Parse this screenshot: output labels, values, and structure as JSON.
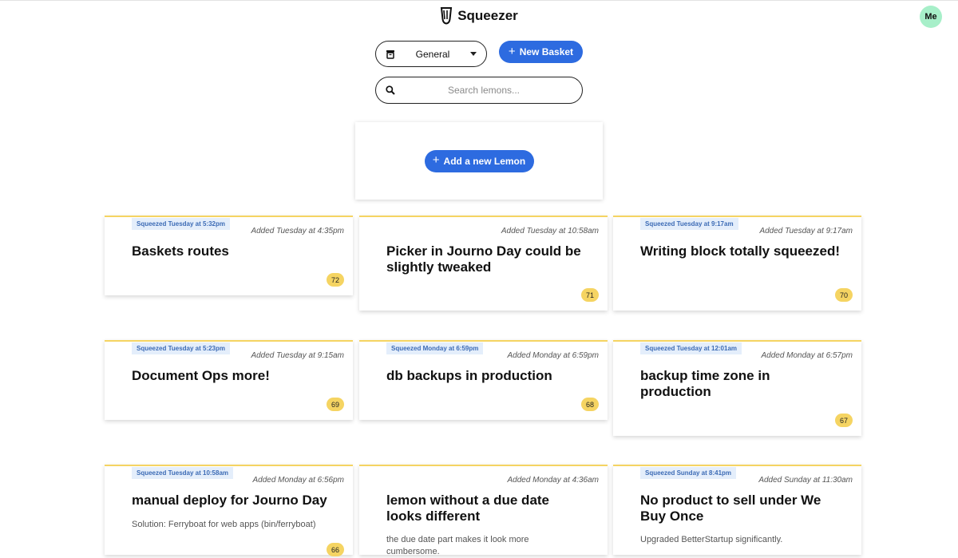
{
  "header": {
    "app_name": "Squeezer",
    "avatar_label": "Me"
  },
  "controls": {
    "basket_selected": "General",
    "new_basket_label": "New Basket",
    "search_placeholder": "Search lemons...",
    "add_lemon_label": "Add a new Lemon"
  },
  "colors": {
    "accent": "#2d6be0",
    "lemon": "#f5d462",
    "avatar": "#a7efc9",
    "squeezed_tag_bg": "#e4eefb"
  },
  "icons": {
    "logo": "squeezer-logo-icon",
    "basket": "basket-icon",
    "search": "search-icon",
    "dropdown": "chevron-down-icon",
    "plus": "plus-icon"
  },
  "lemons": [
    {
      "squeezed": "Squeezed Tuesday at 5:32pm",
      "added": "Added Tuesday at 4:35pm",
      "title": "Baskets routes",
      "description": "",
      "score": "72"
    },
    {
      "squeezed": "",
      "added": "Added Tuesday at 10:58am",
      "title": "Picker in Journo Day could be slightly tweaked",
      "description": "",
      "score": "71"
    },
    {
      "squeezed": "Squeezed Tuesday at 9:17am",
      "added": "Added Tuesday at 9:17am",
      "title": "Writing block totally squeezed!",
      "description": "",
      "score": "70"
    },
    {
      "squeezed": "Squeezed Tuesday at 5:23pm",
      "added": "Added Tuesday at 9:15am",
      "title": "Document Ops more!",
      "description": "",
      "score": "69"
    },
    {
      "squeezed": "Squeezed Monday at 6:59pm",
      "added": "Added Monday at 6:59pm",
      "title": "db backups in production",
      "description": "",
      "score": "68"
    },
    {
      "squeezed": "Squeezed Tuesday at 12:01am",
      "added": "Added Monday at 6:57pm",
      "title": "backup time zone in production",
      "description": "",
      "score": "67"
    },
    {
      "squeezed": "Squeezed Tuesday at 10:58am",
      "added": "Added Monday at 6:56pm",
      "title": "manual deploy for Journo Day",
      "description": "Solution: Ferryboat for web apps (bin/ferryboat)",
      "score": "66"
    },
    {
      "squeezed": "",
      "added": "Added Monday at 4:36am",
      "title": "lemon without a due date looks different",
      "description": "the due date part makes it look more cumbersome.",
      "score": ""
    },
    {
      "squeezed": "Squeezed Sunday at 8:41pm",
      "added": "Added Sunday at 11:30am",
      "title": "No product to sell under We Buy Once",
      "description": "Upgraded BetterStartup significantly.",
      "score": ""
    }
  ]
}
